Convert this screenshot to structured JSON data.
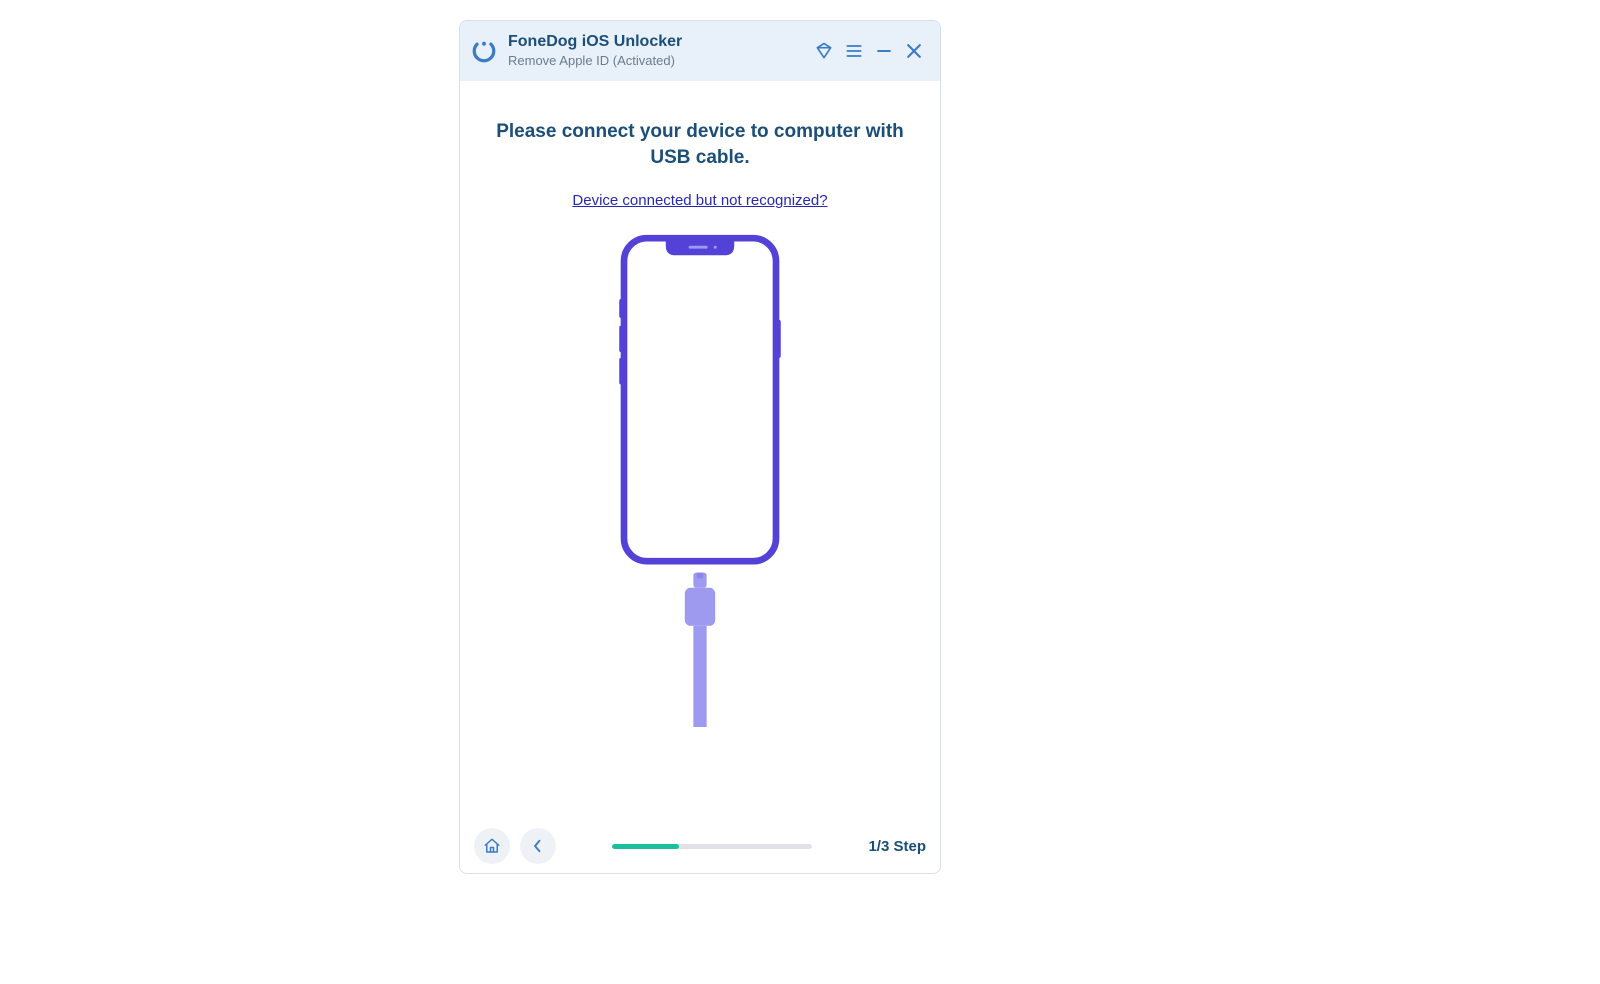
{
  "header": {
    "title": "FoneDog iOS Unlocker",
    "subtitle": "Remove Apple ID  (Activated)"
  },
  "main": {
    "instruction": "Please connect your device to computer with USB cable.",
    "help_link": "Device connected but not recognized?"
  },
  "footer": {
    "step": "1/3 Step"
  },
  "icons": {
    "logo": "fonedog-logo-icon",
    "diamond": "diamond-icon",
    "menu": "menu-icon",
    "minimize": "minimize-icon",
    "close": "close-icon",
    "home": "home-icon",
    "back": "chevron-left-icon",
    "phone": "phone-usb-illustration"
  },
  "colors": {
    "primary": "#1b4e78",
    "accent": "#3a7cc7",
    "link": "#2727b8",
    "phone_outline": "#5441d7",
    "cable": "#9d9af0",
    "progress": "#1bbf9f",
    "titlebar_bg": "#e8f0f9"
  }
}
